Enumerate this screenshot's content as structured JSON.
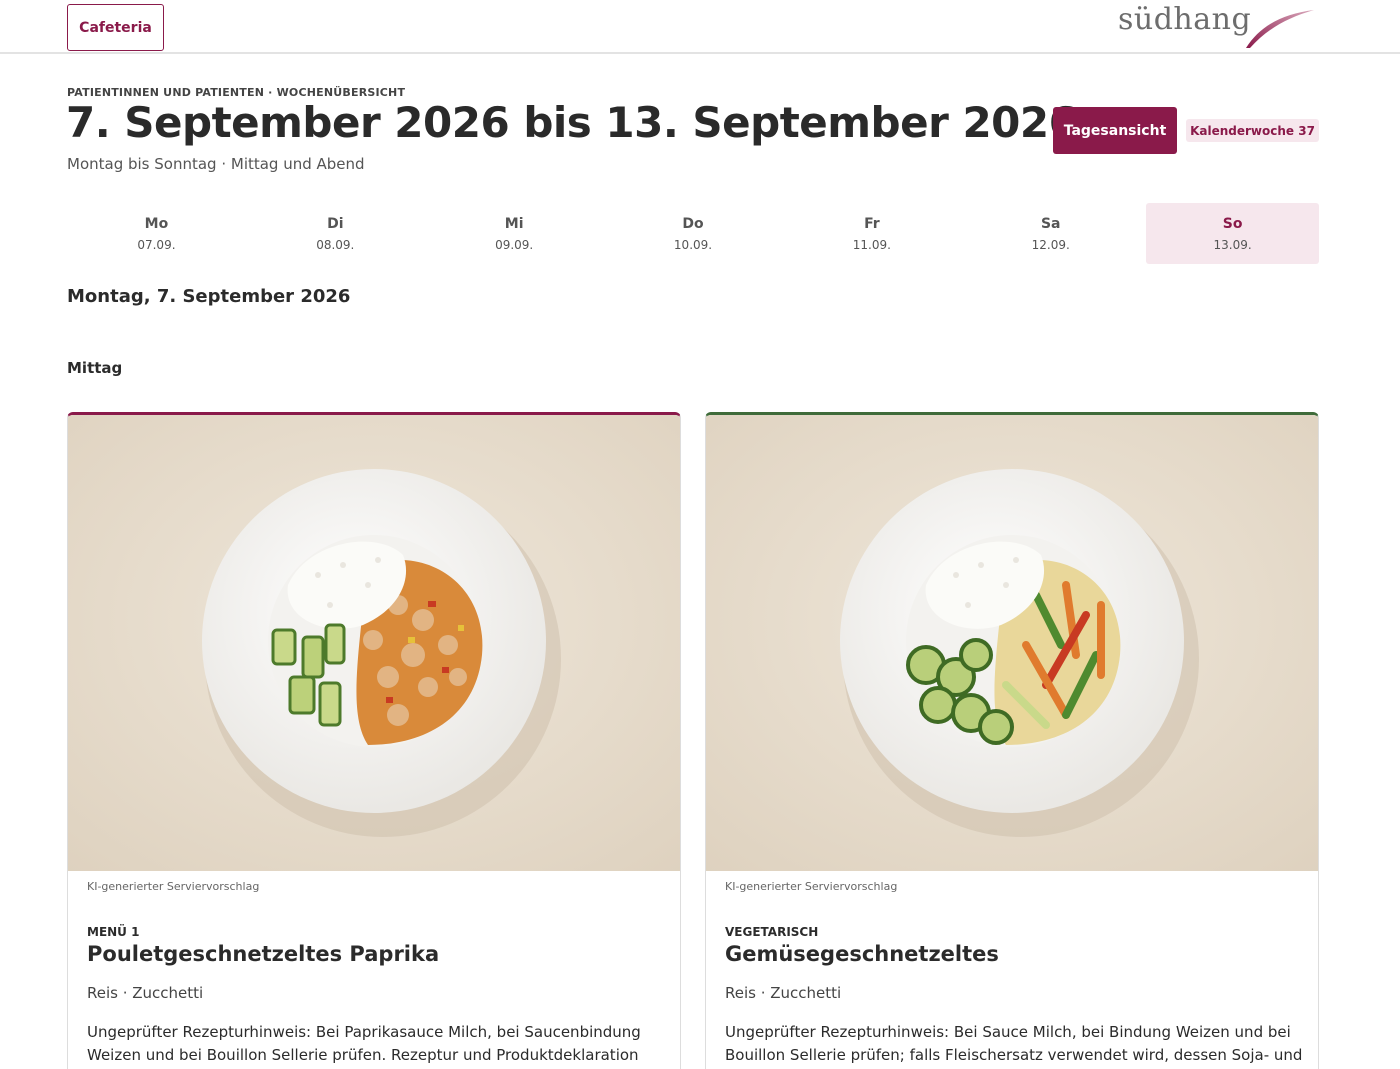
{
  "header": {
    "cafeteria_label": "Cafeteria",
    "logo_text": "südhang"
  },
  "page": {
    "eyebrow": "PATIENTINNEN UND PATIENTEN · WOCHENÜBERSICHT",
    "title": "7. September 2026 bis 13. September 2026",
    "subtitle": "Montag bis Sonntag · Mittag und Abend",
    "day_view_label": "Tagesansicht",
    "week_badge": "Kalenderwoche 37"
  },
  "week": [
    {
      "name": "Mo",
      "date": "07.09."
    },
    {
      "name": "Di",
      "date": "08.09."
    },
    {
      "name": "Mi",
      "date": "09.09."
    },
    {
      "name": "Do",
      "date": "10.09."
    },
    {
      "name": "Fr",
      "date": "11.09."
    },
    {
      "name": "Sa",
      "date": "12.09."
    },
    {
      "name": "So",
      "date": "13.09.",
      "active": true
    }
  ],
  "selected_day": "Montag, 7. September 2026",
  "meal_time": "Mittag",
  "cards": [
    {
      "ai_note": "KI-generierter Serviervorschlag",
      "category": "MENÜ 1",
      "dish": "Pouletgeschnetzeltes Paprika",
      "sides": "Reis · Zucchetti",
      "hint": "Ungeprüfter Rezepturhinweis: Bei Paprikasauce Milch, bei Saucenbindung Weizen und bei Bouillon Sellerie prüfen. Rezeptur und Produktdeklaration prüfen."
    },
    {
      "ai_note": "KI-generierter Serviervorschlag",
      "category": "VEGETARISCH",
      "dish": "Gemüsegeschnetzeltes",
      "sides": "Reis · Zucchetti",
      "hint": "Ungeprüfter Rezepturhinweis: Bei Sauce Milch, bei Bindung Weizen und bei Bouillon Sellerie prüfen; falls Fleischersatz verwendet wird, dessen Soja- und"
    }
  ],
  "colors": {
    "brand": "#8a1a4a",
    "brand_light": "#f6e7ed",
    "vegetarian": "#3f6b3a"
  }
}
